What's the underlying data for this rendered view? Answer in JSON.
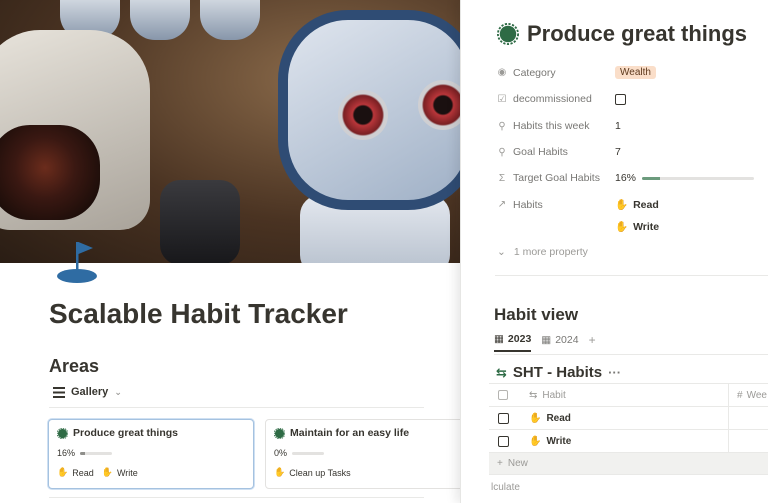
{
  "left_page": {
    "title": "Scalable Habit Tracker",
    "areas_heading": "Areas",
    "view_label": "Gallery",
    "cards": [
      {
        "title": "Produce great things",
        "progress_text": "16%",
        "progress": 0.16,
        "tags": [
          "Read",
          "Write"
        ]
      },
      {
        "title": "Maintain for an easy life",
        "progress_text": "0%",
        "progress": 0.0,
        "tags": [
          "Clean up Tasks"
        ]
      }
    ]
  },
  "peek": {
    "title": "Produce great things",
    "properties": {
      "category": {
        "label": "Category",
        "value": "Wealth"
      },
      "decommissioned": {
        "label": "decommissioned"
      },
      "habits_this_week": {
        "label": "Habits this week",
        "value": "1"
      },
      "goal_habits": {
        "label": "Goal Habits",
        "value": "7"
      },
      "target_goal_habits": {
        "label": "Target Goal Habits",
        "value": "16%",
        "progress": 0.16
      },
      "habits": {
        "label": "Habits",
        "values": [
          "Read",
          "Write"
        ]
      }
    },
    "more_property": "1 more property",
    "habit_view": {
      "heading": "Habit view",
      "tabs": [
        "2023",
        "2024"
      ],
      "database_title": "SHT - Habits",
      "columns": {
        "habit": "Habit",
        "week": "Wee"
      },
      "rows": [
        "Read",
        "Write"
      ],
      "new_label": "New",
      "calculate_label": "lculate"
    }
  },
  "colors": {
    "accent_green": "#6c9b7d",
    "chip_bg": "#fadec9",
    "selected_border": "#a5c2e0"
  }
}
